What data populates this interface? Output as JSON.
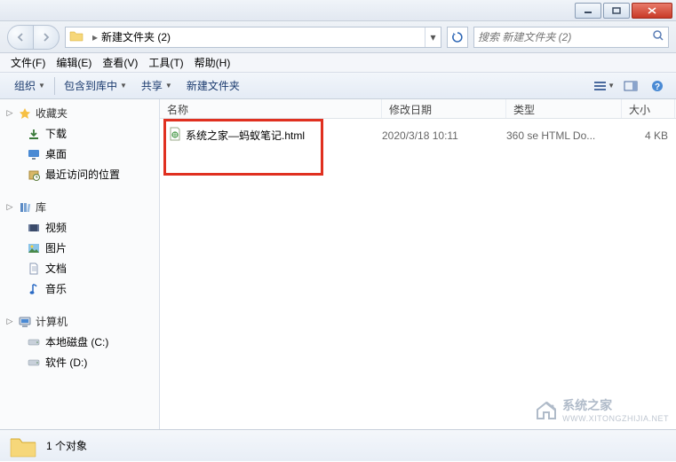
{
  "titlebar": {},
  "nav": {
    "path_label": "新建文件夹 (2)",
    "search_placeholder": "搜索 新建文件夹 (2)"
  },
  "menu": {
    "file": "文件(F)",
    "edit": "编辑(E)",
    "view": "查看(V)",
    "tools": "工具(T)",
    "help": "帮助(H)"
  },
  "toolbar": {
    "organize": "组织",
    "include": "包含到库中",
    "share": "共享",
    "newfolder": "新建文件夹"
  },
  "sidebar": {
    "favorites": {
      "label": "收藏夹",
      "items": [
        "下载",
        "桌面",
        "最近访问的位置"
      ]
    },
    "libraries": {
      "label": "库",
      "items": [
        "视频",
        "图片",
        "文档",
        "音乐"
      ]
    },
    "computer": {
      "label": "计算机",
      "items": [
        "本地磁盘 (C:)",
        "软件 (D:)"
      ]
    }
  },
  "columns": {
    "name": "名称",
    "date": "修改日期",
    "type": "类型",
    "size": "大小"
  },
  "files": [
    {
      "name": "系统之家—蚂蚁笔记.html",
      "date": "2020/3/18 10:11",
      "type": "360 se HTML Do...",
      "size": "4 KB"
    }
  ],
  "status": {
    "count_label": "1 个对象"
  },
  "watermark": {
    "title": "系统之家",
    "sub": "WWW.XITONGZHIJIA.NET"
  }
}
